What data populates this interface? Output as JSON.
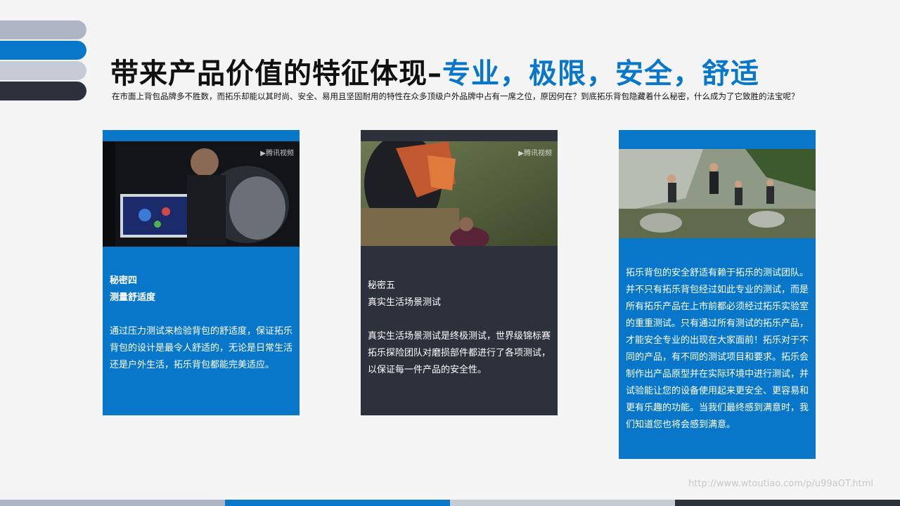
{
  "title": {
    "main": "带来产品价值的特征体现–",
    "highlight": "专业，极限，安全，舒适"
  },
  "subtitle": "在市面上背包品牌多不胜数，而拓乐却能以其时尚、安全、易用且坚固耐用的特性在众多顶级户外品牌中占有一席之位，原因何在？到底拓乐背包隐藏着什么秘密，什么成为了它致胜的法宝呢？",
  "cards": [
    {
      "heading_line1": "秘密四",
      "heading_line2": "测量舒适度",
      "body": "通过压力测试来检验背包的舒适度，保证拓乐背包的设计是最令人舒适的，无论是日常生活还是户外生活，拓乐背包都能完美适应。",
      "watermark": "▶腾讯视频"
    },
    {
      "heading_line1": "秘密五",
      "heading_line2": "真实生活场景测试",
      "body": "真实生活场景测试是终极测试，世界级锦标赛拓乐探险团队对磨损部件都进行了各项测试，以保证每一件产品的安全性。",
      "watermark": "▶腾讯视频"
    },
    {
      "body": "拓乐背包的安全舒适有赖于拓乐的测试团队。并不只有拓乐背包经过如此专业的测试，而是所有拓乐产品在上市前都必须经过拓乐实验室的重重测试。只有通过所有测试的拓乐产品，才能安全专业的出现在大家面前！拓乐对于不同的产品，有不同的测试项目和要求。拓乐会制作出产品原型并在实际环境中进行测试，并试验能让您的设备使用起来更安全、更容易和更有乐趣的功能。当我们最终感到满意时，我们知道您也将会感到满意。"
    }
  ],
  "footer_url": "http://www.wtoutiao.com/p/u99aOT.html",
  "colors": {
    "accent_blue": "#0877c9",
    "dark": "#2c313c",
    "light_gray": "#c7cbd5",
    "mid_gray": "#aeb5c5"
  }
}
